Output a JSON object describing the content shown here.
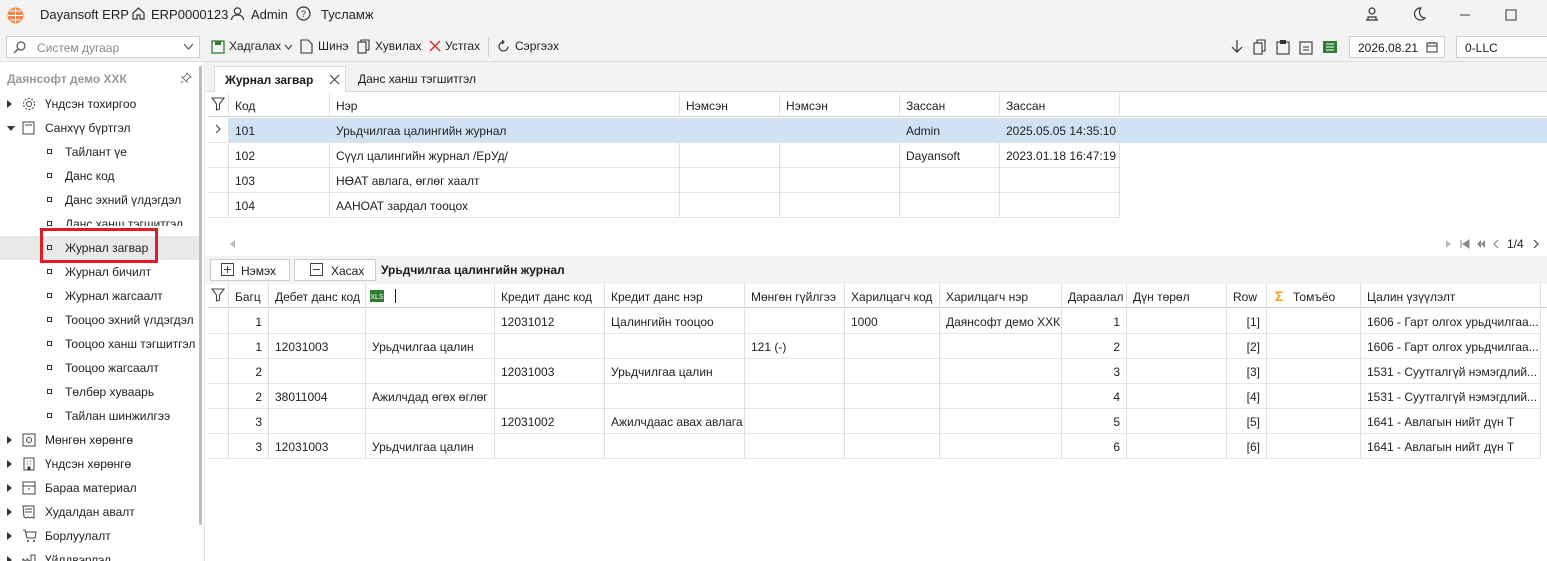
{
  "app": {
    "title": "Dayansoft ERP",
    "code": "ERP0000123",
    "user": "Admin",
    "help": "Тусламж"
  },
  "toolbar": {
    "search_placeholder": "Систем дугаар",
    "save": "Хадгалах",
    "new": "Шинэ",
    "copy": "Хувилах",
    "delete": "Устгах",
    "refresh": "Сэргээх",
    "date": "2026.08.21",
    "company": "0-LLC"
  },
  "sidebar": {
    "title": "Даянсофт демо ХХК",
    "items": [
      {
        "label": "Үндсэн тохиргоо"
      },
      {
        "label": "Санхүү бүртгэл"
      },
      {
        "label": "Тайлант үе"
      },
      {
        "label": "Данс код"
      },
      {
        "label": "Данс эхний үлдэгдэл"
      },
      {
        "label": "Данс ханш тэгшитгэл"
      },
      {
        "label": "Журнал загвар"
      },
      {
        "label": "Журнал бичилт"
      },
      {
        "label": "Журнал жагсаалт"
      },
      {
        "label": "Тооцоо эхний үлдэгдэл"
      },
      {
        "label": "Тооцоо ханш тэгшитгэл"
      },
      {
        "label": "Тооцоо жагсаалт"
      },
      {
        "label": "Төлбөр хуваарь"
      },
      {
        "label": "Тайлан шинжилгээ"
      },
      {
        "label": "Мөнгөн хөрөнгө"
      },
      {
        "label": "Үндсэн хөрөнгө"
      },
      {
        "label": "Бараа материал"
      },
      {
        "label": "Худалдан авалт"
      },
      {
        "label": "Борлуулалт"
      },
      {
        "label": "Үйлдвэрлэл"
      }
    ]
  },
  "tabs": [
    {
      "label": "Журнал загвар"
    },
    {
      "label": "Данс ханш тэгшитгэл"
    }
  ],
  "top_grid": {
    "headers": [
      "Код",
      "Нэр",
      "Нэмсэн",
      "Нэмсэн",
      "Засcан",
      "Засcан"
    ],
    "rows": [
      [
        "101",
        "Урьдчилгаа цалингийн журнал",
        "",
        "",
        "Admin",
        "2025.05.05 14:35:10"
      ],
      [
        "102",
        "Сүүл цалингийн журнал /ЕрУд/",
        "",
        "",
        "Dayansoft",
        "2023.01.18 16:47:19"
      ],
      [
        "103",
        "НӨАТ авлага, өглөг хаалт",
        "",
        "",
        "",
        ""
      ],
      [
        "104",
        "ААНОАТ зардал тооцох",
        "",
        "",
        "",
        ""
      ]
    ]
  },
  "pager": {
    "page": "1/4"
  },
  "bottom_bar": {
    "add": "Нэмэх",
    "remove": "Хасах",
    "journal_title": "Урьдчилгаа цалингийн журнал"
  },
  "bottom_grid": {
    "headers": [
      "Багц",
      "Дебет данс код",
      "",
      "Кредит данс код",
      "Кредит данс нэр",
      "Мөнгөн гүйлгээ",
      "Харилцагч код",
      "Харилцагч нэр",
      "Дараалал",
      "Дүн төрөл",
      "Row",
      "Томъёо",
      "Цалин үзүүлэлт"
    ],
    "rows": [
      [
        "1",
        "",
        "",
        "12031012",
        "Цалингийн тооцоо",
        "",
        "1000",
        "Даянсофт демо ХХК",
        "1",
        "",
        "[1]",
        "",
        "1606 - Гарт олгох урьдчилгаа..."
      ],
      [
        "1",
        "12031003",
        "Урьдчилгаа цалин",
        "",
        "",
        "121 (-)",
        "",
        "",
        "2",
        "",
        "[2]",
        "",
        "1606 - Гарт олгох урьдчилгаа..."
      ],
      [
        "2",
        "",
        "",
        "12031003",
        "Урьдчилгаа цалин",
        "",
        "",
        "",
        "3",
        "",
        "[3]",
        "",
        "1531 - Суутгалгүй нэмэгдлий..."
      ],
      [
        "2",
        "38011004",
        "Ажилчдад өгөх өглөг",
        "",
        "",
        "",
        "",
        "",
        "4",
        "",
        "[4]",
        "",
        "1531 - Суутгалгүй нэмэгдлий..."
      ],
      [
        "3",
        "",
        "",
        "12031002",
        "Ажилчдаас авах авлага",
        "",
        "",
        "",
        "5",
        "",
        "[5]",
        "",
        "1641 - Авлагын нийт дүн Т"
      ],
      [
        "3",
        "12031003",
        "Урьдчилгаа цалин",
        "",
        "",
        "",
        "",
        "",
        "6",
        "",
        "[6]",
        "",
        "1641 - Авлагын нийт дүн Т"
      ]
    ]
  },
  "colors": {
    "selected_row": "#cfe3f5",
    "highlight_border": "#e01b24",
    "delete_icon": "#d32f2f",
    "save_icon": "#2e7d32",
    "sigma": "#f0a30a"
  }
}
